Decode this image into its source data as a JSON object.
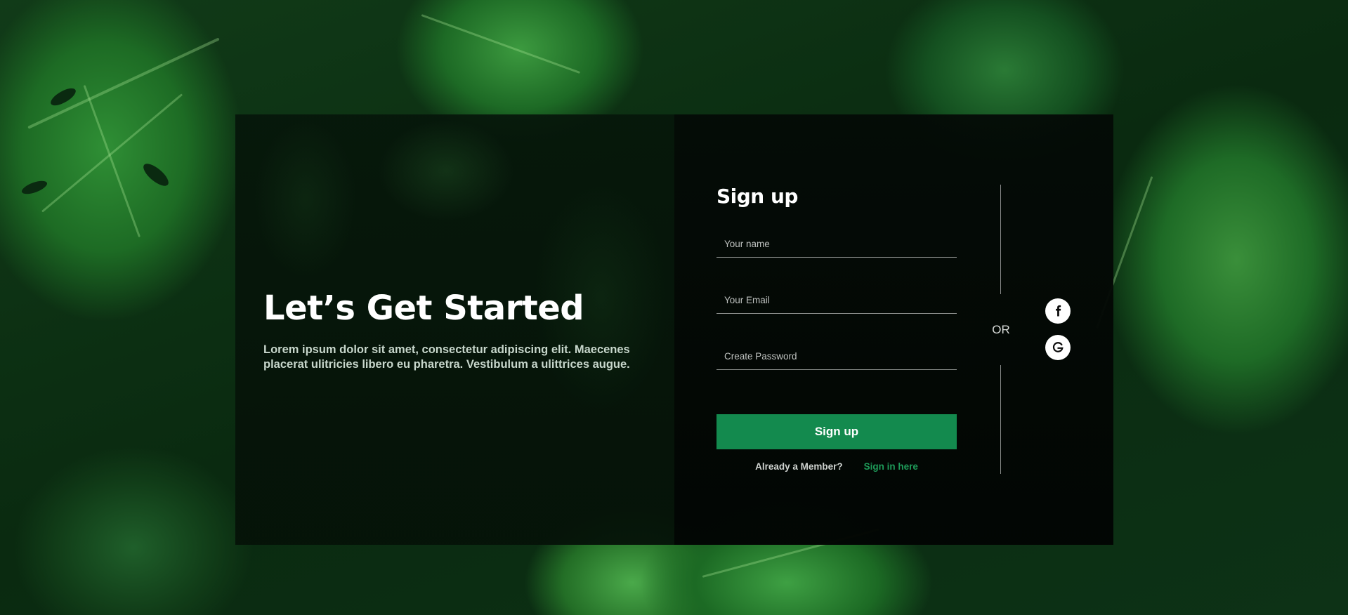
{
  "hero": {
    "title": "Let’s Get Started",
    "description": "Lorem ipsum dolor sit amet, consectetur adipiscing elit. Maecenes placerat ulitricies libero eu pharetra. Vestibulum a ulittrices augue."
  },
  "form": {
    "title": "Sign up",
    "name_placeholder": "Your name",
    "email_placeholder": "Your Email",
    "password_placeholder": "Create Password",
    "submit_label": "Sign up",
    "member_text": "Already a Member?",
    "signin_label": "Sign in here"
  },
  "social": {
    "or_label": "OR",
    "providers": [
      "facebook-icon",
      "google-icon"
    ]
  },
  "colors": {
    "accent": "#138a4e",
    "link": "#1e9b59",
    "background": "#0b2e12"
  }
}
